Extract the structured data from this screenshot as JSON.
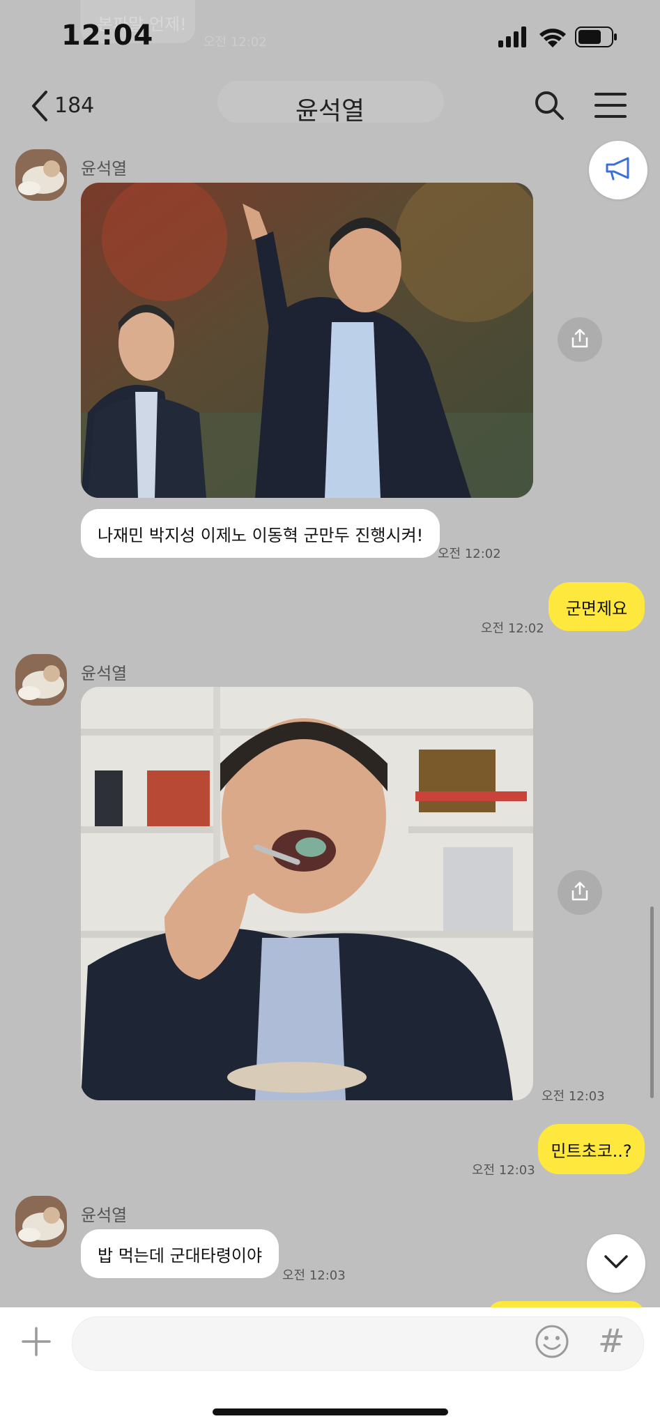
{
  "status_bar": {
    "time": "12:04"
  },
  "ghost_message": {
    "text": "본파말 언제!",
    "time": "오전 12:02"
  },
  "header": {
    "back_count": "184",
    "title": "윤석열"
  },
  "messages": [
    {
      "sender": "윤석열",
      "type": "image",
      "image_desc": "photo-two-men-pointing"
    },
    {
      "sender": "윤석열",
      "type": "text",
      "text": "나재민 박지성 이제노 이동혁 군만두 진행시켜!",
      "time": "오전 12:02"
    },
    {
      "sender": "me",
      "type": "text",
      "text": "군면제요",
      "time": "오전 12:02"
    },
    {
      "sender": "윤석열",
      "type": "image",
      "image_desc": "photo-man-eating",
      "time": "오전 12:03"
    },
    {
      "sender": "me",
      "type": "text",
      "text": "민트초코..?",
      "time": "오전 12:03"
    },
    {
      "sender": "윤석열",
      "type": "text",
      "text": "밥 먹는데 군대타령이야",
      "time": "오전 12:03"
    }
  ],
  "input_bar": {
    "placeholder": ""
  },
  "colors": {
    "background": "#bfbfbf",
    "my_bubble": "#fee83e",
    "their_bubble": "#ffffff"
  }
}
